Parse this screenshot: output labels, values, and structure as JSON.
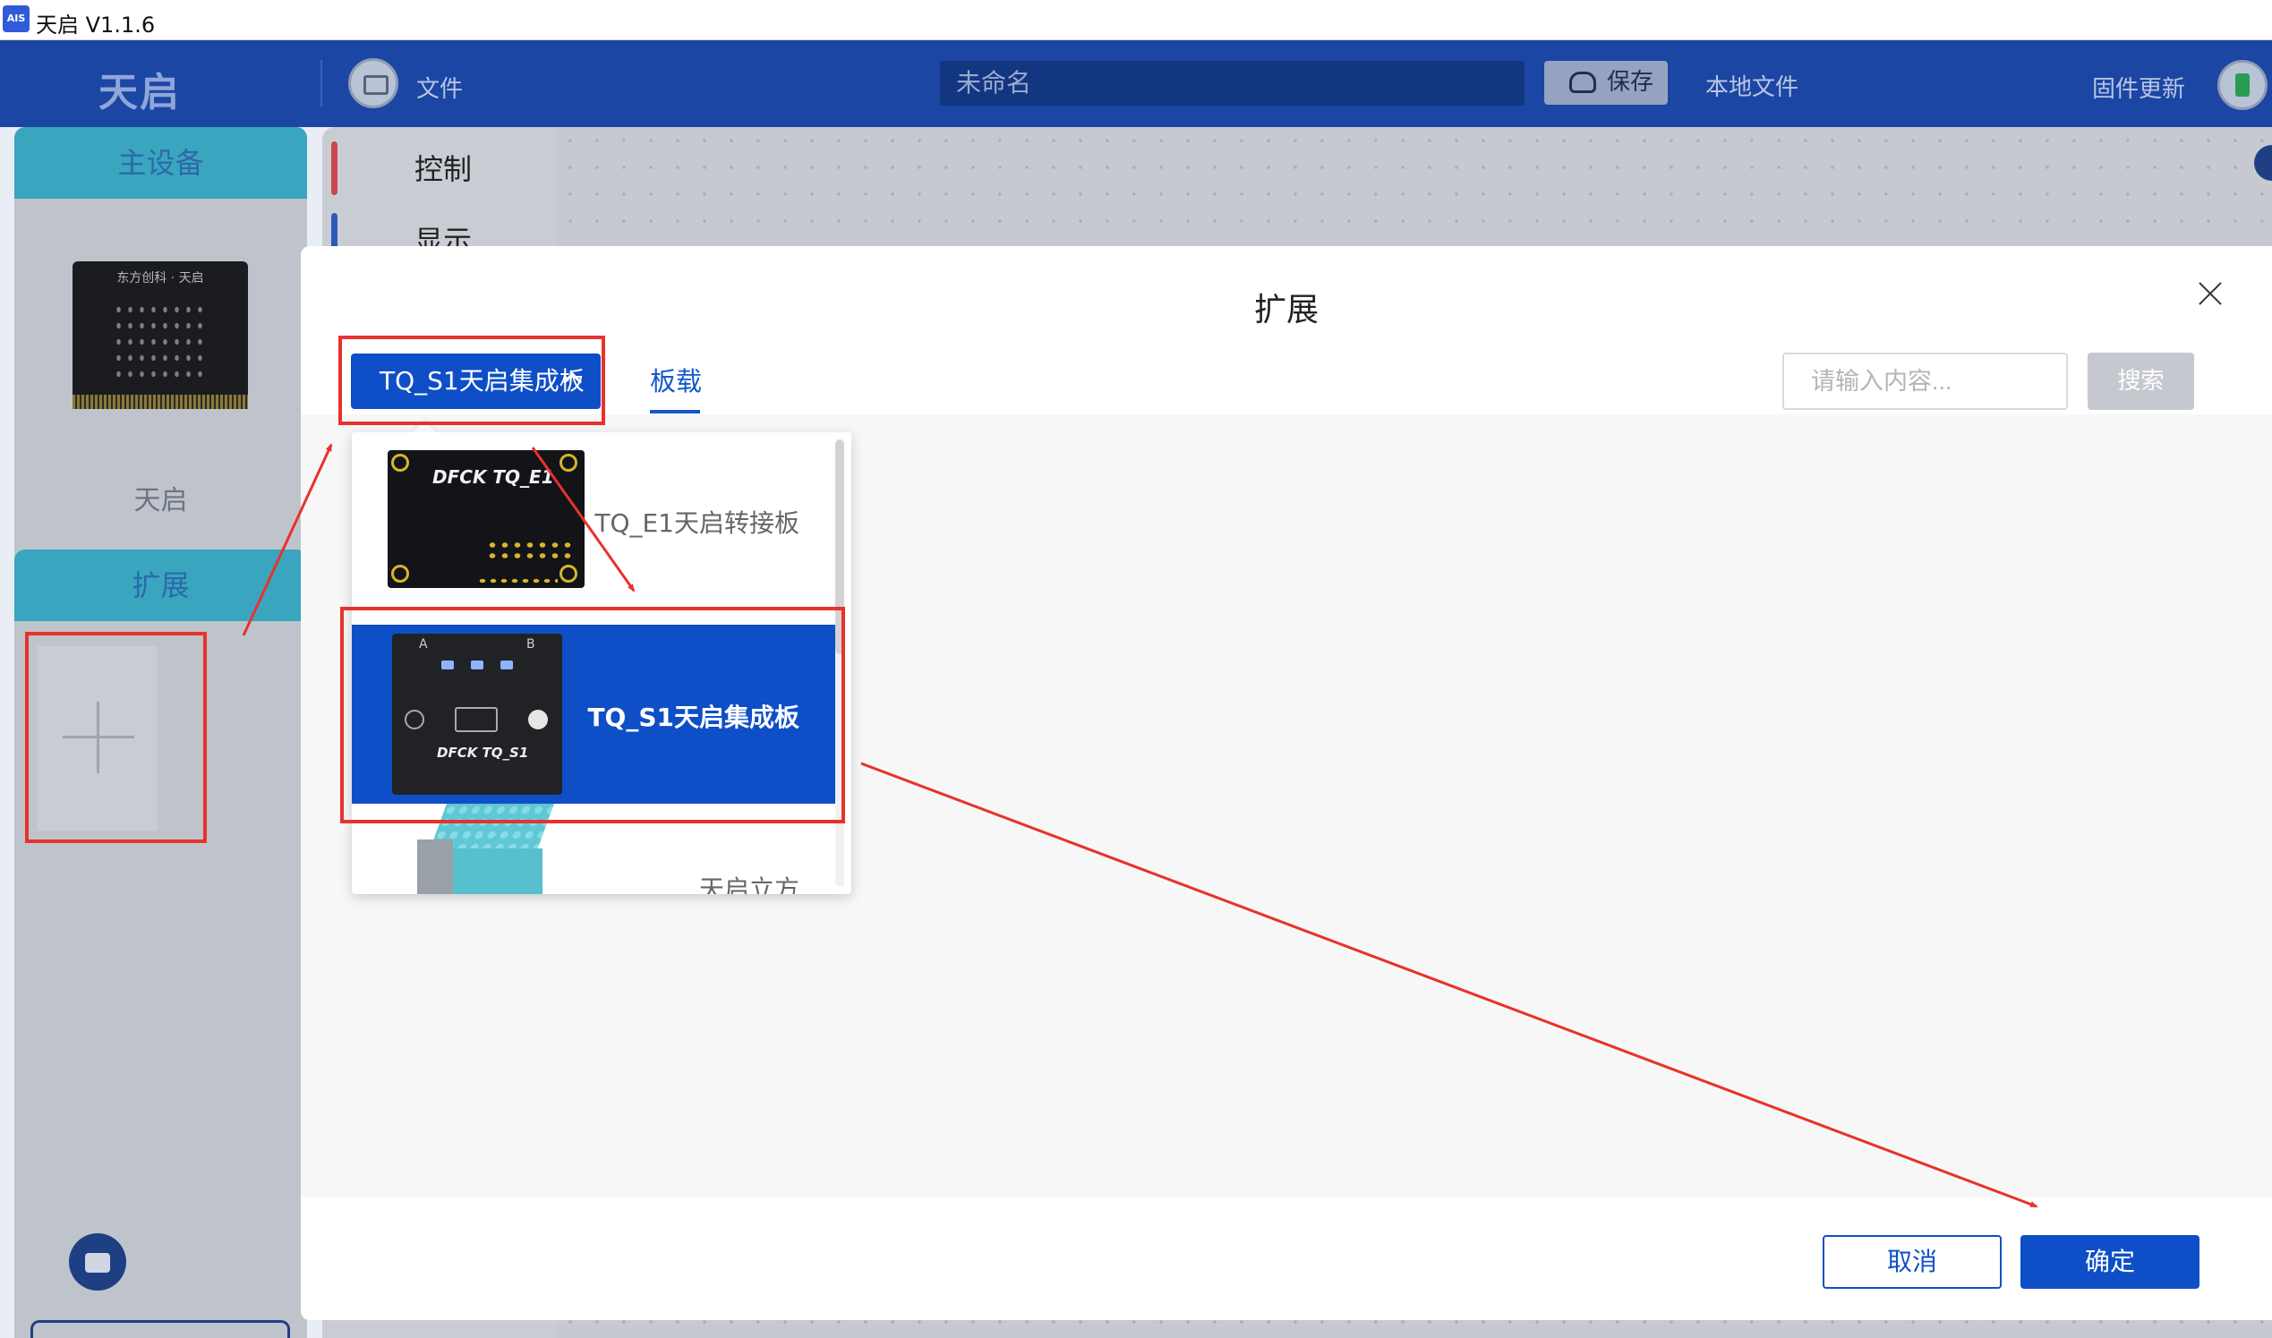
{
  "window": {
    "title": "天启 V1.1.6",
    "icon": "app-icon"
  },
  "header": {
    "logo": "天启",
    "file_label": "文件",
    "filename": "未命名",
    "save_label": "保存",
    "local_file_label": "本地文件",
    "firmware_update_label": "固件更新",
    "icons": [
      "folder-icon",
      "cloud-save-icon",
      "user-avatar-icon"
    ]
  },
  "sidebar": {
    "main_device_title": "主设备",
    "device_name": "天启",
    "extension_title": "扩展",
    "add_icon": "plus-icon",
    "toolbox_icon": "toolbox-icon"
  },
  "workspace": {
    "categories": [
      {
        "label": "控制",
        "color": "#c8484d"
      },
      {
        "label": "显示",
        "color": "#2f59b8"
      }
    ]
  },
  "modal": {
    "title": "扩展",
    "selected_option": "TQ_S1天启集成板",
    "tab_label": "板载",
    "search_placeholder": "请输入内容...",
    "search_button": "搜索",
    "cancel_button": "取消",
    "confirm_button": "确定",
    "options": [
      {
        "label": "TQ_E1天启转接板",
        "selected": false
      },
      {
        "label": "TQ_S1天启集成板",
        "selected": true
      },
      {
        "label": "天启立方",
        "selected": false
      }
    ]
  },
  "colors": {
    "primary": "#0e4fc7",
    "header_bg": "#1c46a4",
    "annotation_red": "#e8322b"
  }
}
